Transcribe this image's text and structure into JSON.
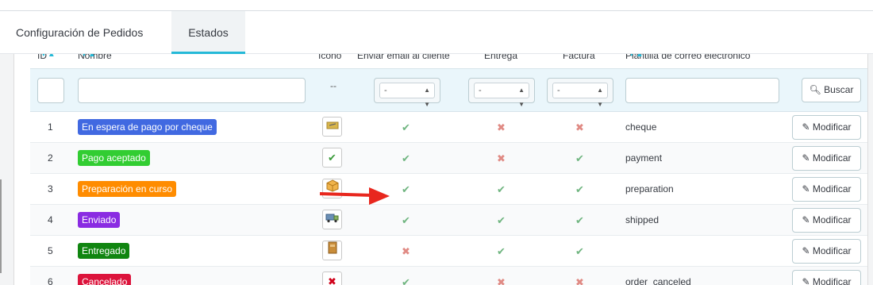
{
  "tabs": [
    {
      "label": "Configuración de Pedidos",
      "active": false
    },
    {
      "label": "Estados",
      "active": true
    }
  ],
  "table": {
    "headers": {
      "id": "ID",
      "name": "Nombre",
      "icon": "Icono",
      "send_email": "Enviar email al cliente",
      "delivery": "Entrega",
      "invoice": "Factura",
      "template": "Plantilla de correo electrónico"
    },
    "sort_arrows": "▼▲",
    "filters": {
      "icon_placeholder": "--",
      "select_value": "-",
      "search_label": "Buscar"
    },
    "edit_label": "Modificar",
    "rows": [
      {
        "id": "1",
        "name": "En espera de pago por cheque",
        "color": "#4169e1",
        "icon": "cheque-icon",
        "send_email": true,
        "delivery": false,
        "invoice": false,
        "template": "cheque"
      },
      {
        "id": "2",
        "name": "Pago aceptado",
        "color": "#32cd32",
        "icon": "check-icon",
        "send_email": true,
        "delivery": false,
        "invoice": true,
        "template": "payment"
      },
      {
        "id": "3",
        "name": "Preparación en curso",
        "color": "#ff8c00",
        "icon": "box-icon",
        "send_email": true,
        "delivery": true,
        "invoice": true,
        "template": "preparation"
      },
      {
        "id": "4",
        "name": "Enviado",
        "color": "#8a2be2",
        "icon": "truck-icon",
        "send_email": true,
        "delivery": true,
        "invoice": true,
        "template": "shipped"
      },
      {
        "id": "5",
        "name": "Entregado",
        "color": "#108510",
        "icon": "package-icon",
        "send_email": false,
        "delivery": true,
        "invoice": true,
        "template": ""
      },
      {
        "id": "6",
        "name": "Cancelado",
        "color": "#dc143c",
        "icon": "cancel-icon",
        "send_email": true,
        "delivery": false,
        "invoice": false,
        "template": "order_canceled"
      }
    ]
  },
  "annotation": {
    "arrow_color": "#e8271e"
  }
}
